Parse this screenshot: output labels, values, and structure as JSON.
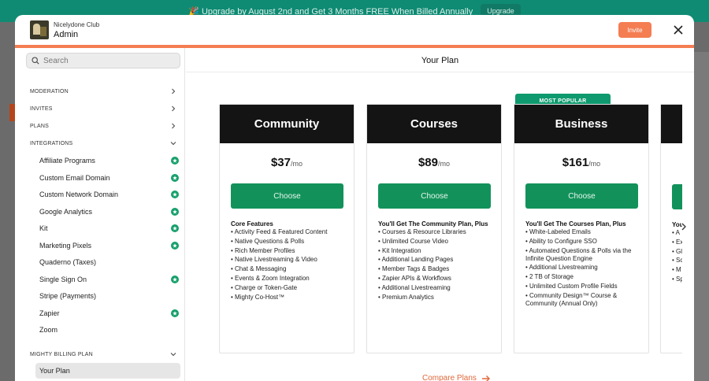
{
  "banner": {
    "text": "🎉 Upgrade by August 2nd and Get 3 Months FREE When Billed Annually",
    "button": "Upgrade"
  },
  "header": {
    "club_name": "Nicelydone Club",
    "role": "Admin",
    "invite_label": "Invite",
    "accent_color": "#f47d52"
  },
  "sidebar": {
    "search_placeholder": "Search",
    "sections": [
      {
        "label": "MODERATION"
      },
      {
        "label": "INVITES"
      },
      {
        "label": "PLANS"
      },
      {
        "label": "INTEGRATIONS"
      },
      {
        "label": "MIGHTY BILLING PLAN"
      }
    ],
    "integrations": [
      {
        "label": "Affiliate Programs",
        "connected": true
      },
      {
        "label": "Custom Email Domain",
        "connected": true
      },
      {
        "label": "Custom Network Domain",
        "connected": true
      },
      {
        "label": "Google Analytics",
        "connected": true
      },
      {
        "label": "Kit",
        "connected": true
      },
      {
        "label": "Marketing Pixels",
        "connected": true
      },
      {
        "label": "Quaderno (Taxes)",
        "connected": false
      },
      {
        "label": "Single Sign On",
        "connected": true
      },
      {
        "label": "Stripe (Payments)",
        "connected": false
      },
      {
        "label": "Zapier",
        "connected": true
      },
      {
        "label": "Zoom",
        "connected": false
      }
    ],
    "billing_items": [
      {
        "label": "Your Plan",
        "active": true
      }
    ]
  },
  "main": {
    "title": "Your Plan",
    "popular_badge": "MOST POPULAR",
    "plans": [
      {
        "name": "Community",
        "price": "$37",
        "period": "/mo",
        "button": "Choose",
        "features_title": "Core Features",
        "features": [
          "• Activity Feed & Featured Content",
          "• Native Questions & Polls",
          "• Rich Member Profiles",
          "• Native Livestreaming & Video",
          "• Chat & Messaging",
          "• Events & Zoom Integration",
          "• Charge or Token-Gate",
          "• Mighty Co-Host™"
        ]
      },
      {
        "name": "Courses",
        "price": "$89",
        "period": "/mo",
        "button": "Choose",
        "features_title": "You'll Get The Community Plan, Plus",
        "features": [
          "• Courses & Resource Libraries",
          "• Unlimited Course Video",
          "• Kit Integration",
          "• Additional Landing Pages",
          "• Member Tags & Badges",
          "• Zapier APIs & Workflows",
          "• Additional Livestreaming",
          "• Premium Analytics"
        ]
      },
      {
        "name": "Business",
        "price": "$161",
        "period": "/mo",
        "button": "Choose",
        "features_title": "You'll Get The Courses Plan, Plus",
        "features": [
          "• White-Labeled Emails",
          "• Ability to Configure SSO",
          "• Automated Questions & Polls via the Infinite Question Engine",
          "• Additional Livestreaming",
          "• 2 TB of Storage",
          "• Unlimited Custom Profile Fields",
          "• Community Design™ Course & Community (Annual Only)"
        ]
      },
      {
        "name": "",
        "price": "",
        "period": "",
        "button": "",
        "features_title": "You",
        "features": [
          "• A",
          "• Ex",
          "• Gl",
          "• Sc",
          "• M",
          "• Sp"
        ]
      }
    ],
    "compare_label": "Compare Plans",
    "brand_green": "#12925a"
  }
}
